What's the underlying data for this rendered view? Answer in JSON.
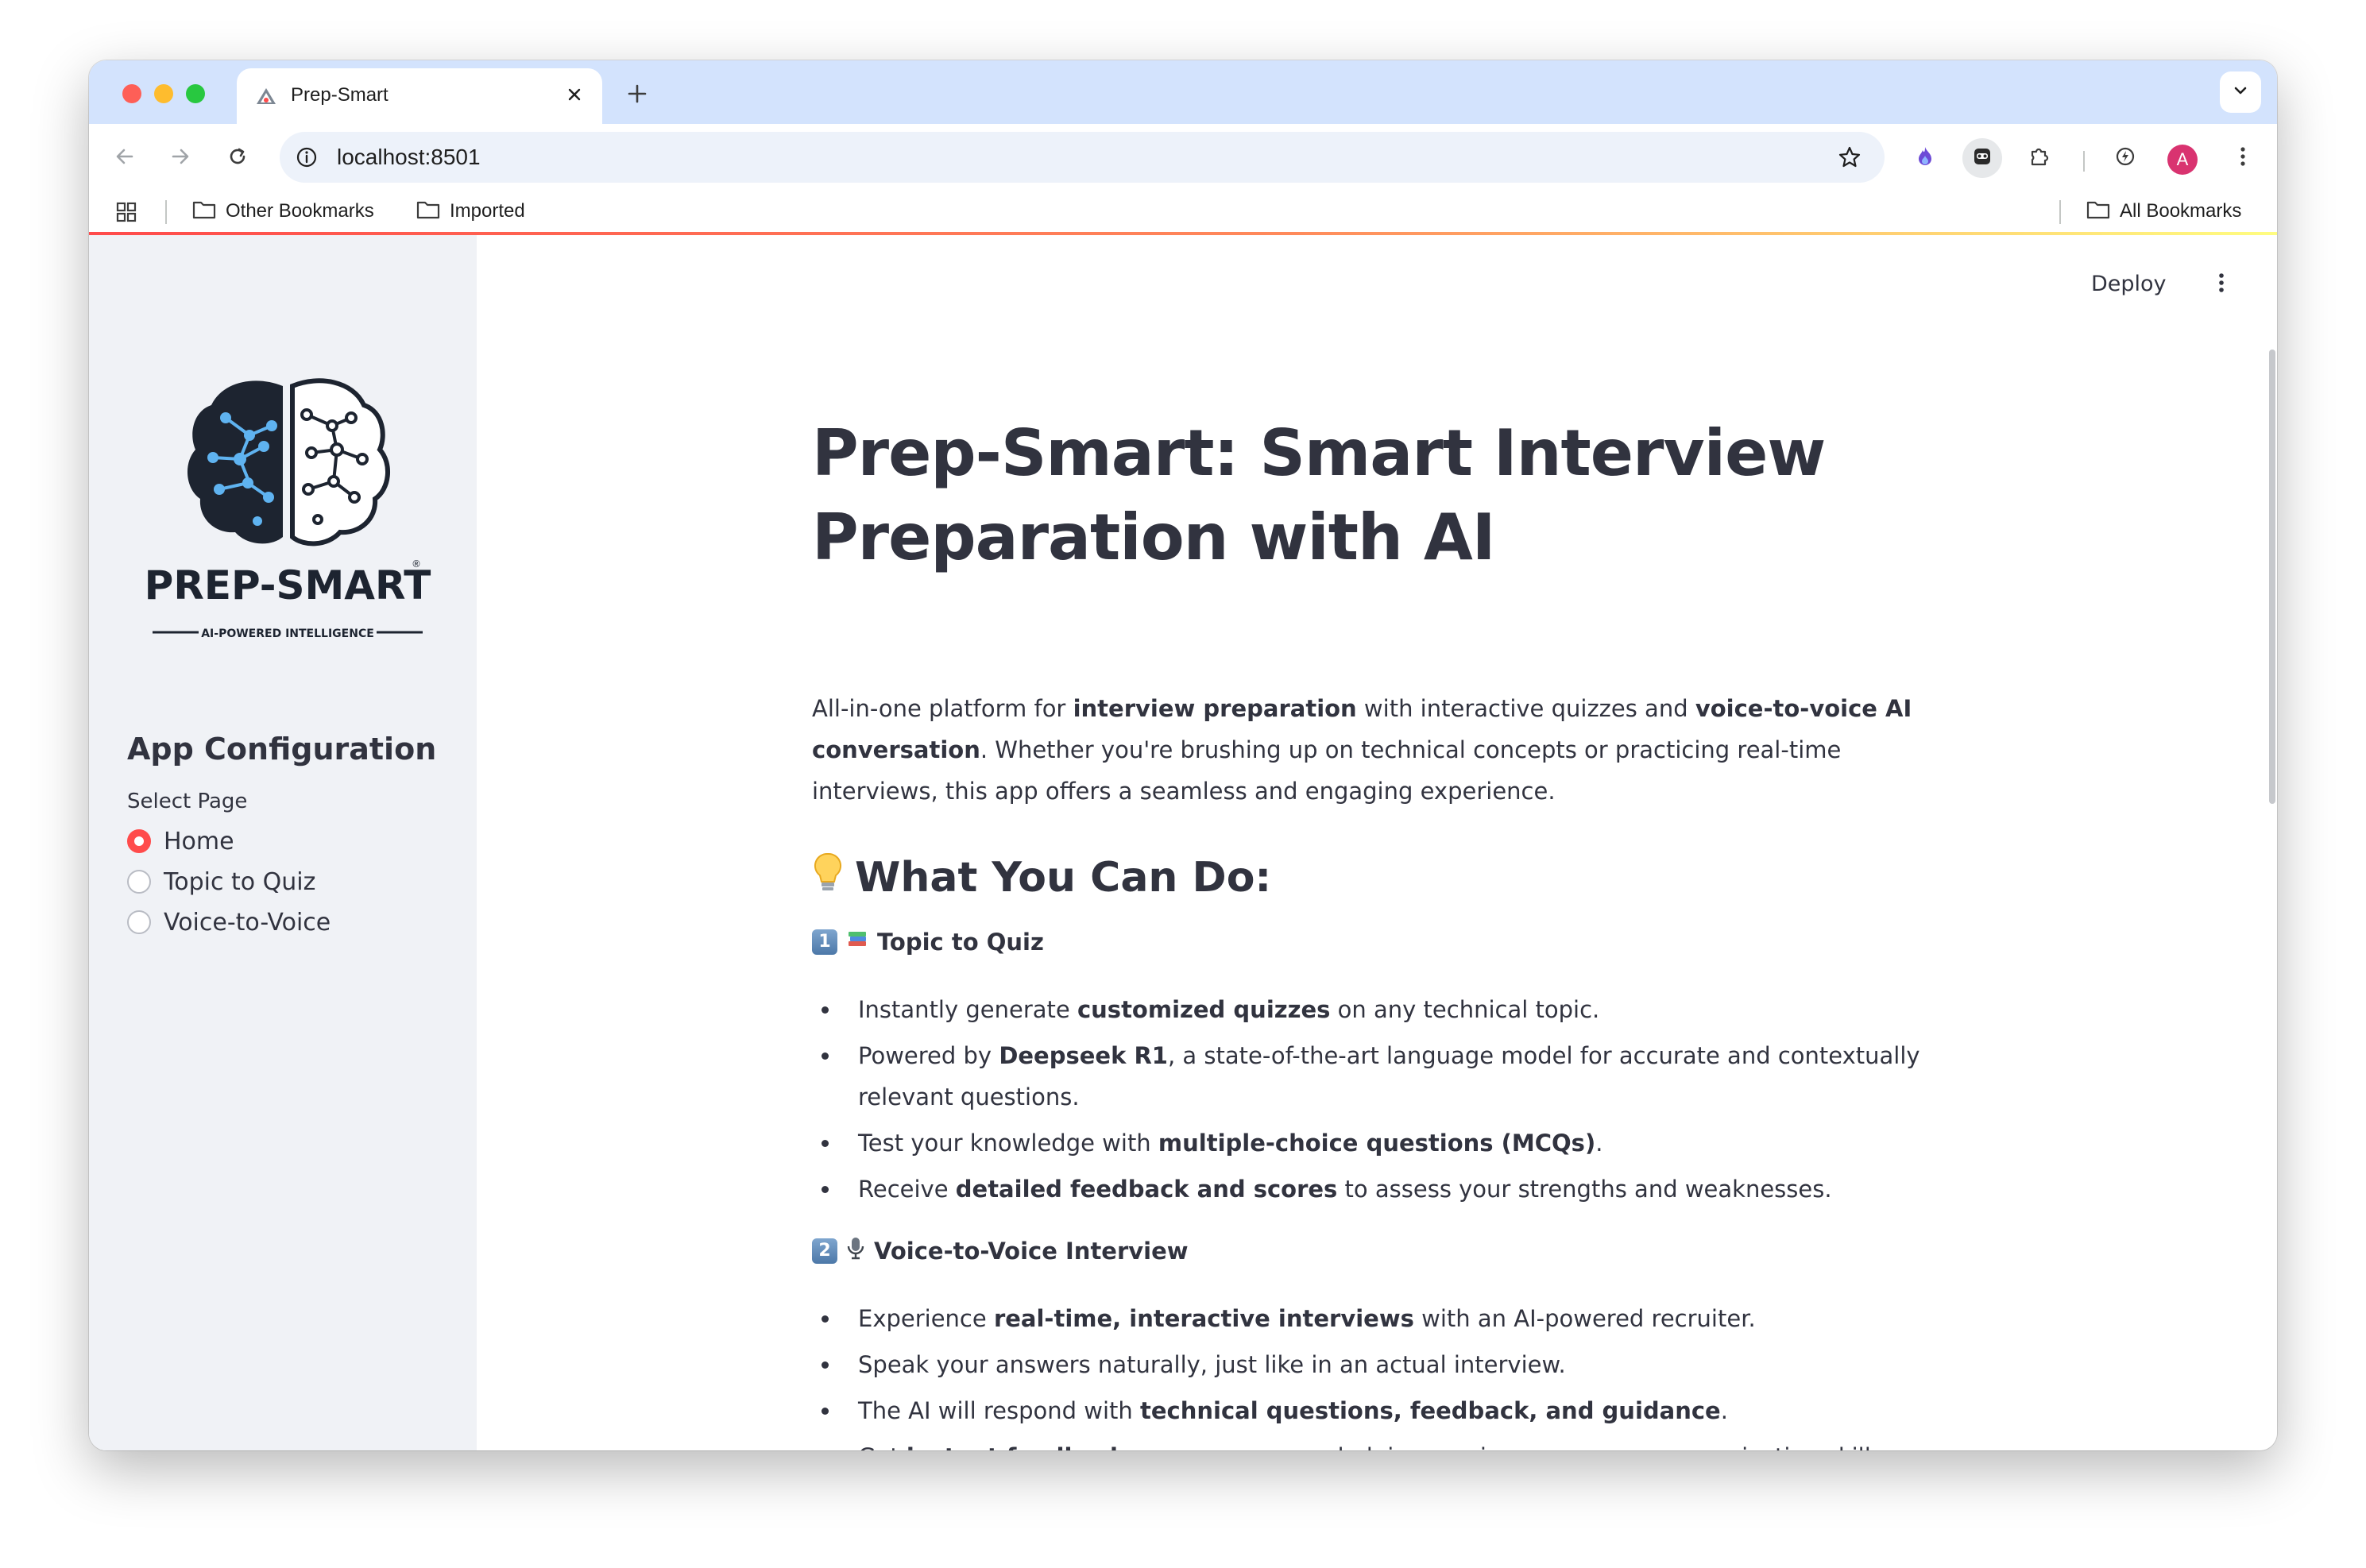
{
  "browser": {
    "tab_title": "Prep-Smart",
    "url": "localhost:8501",
    "avatar_initial": "A",
    "bookmarks": {
      "other": "Other Bookmarks",
      "imported": "Imported",
      "all": "All Bookmarks"
    }
  },
  "header": {
    "deploy": "Deploy"
  },
  "sidebar": {
    "logo_text": "PREP-SMART",
    "logo_tagline": "AI-POWERED INTELLIGENCE",
    "heading": "App Configuration",
    "select_label": "Select Page",
    "options": [
      "Home",
      "Topic to Quiz",
      "Voice-to-Voice"
    ],
    "selected": "Home"
  },
  "main": {
    "title": "Prep-Smart: Smart Interview Preparation with AI",
    "intro": {
      "t1": "All-in-one platform for ",
      "b1": "interview preparation",
      "t2": " with interactive quizzes and ",
      "b2": "voice-to-voice AI conversation",
      "t3": ". Whether you're brushing up on technical concepts or practicing real-time interviews, this app offers a seamless and engaging experience."
    },
    "what_heading": "What You Can Do:",
    "section1": {
      "num": "1",
      "title": "Topic to Quiz",
      "items": [
        {
          "pre": "Instantly generate ",
          "bold": "customized quizzes",
          "post": " on any technical topic."
        },
        {
          "pre": "Powered by ",
          "bold": "Deepseek R1",
          "post": ", a state-of-the-art language model for accurate and contextually relevant questions."
        },
        {
          "pre": "Test your knowledge with ",
          "bold": "multiple-choice questions (MCQs)",
          "post": "."
        },
        {
          "pre": "Receive ",
          "bold": "detailed feedback and scores",
          "post": " to assess your strengths and weaknesses."
        }
      ]
    },
    "section2": {
      "num": "2",
      "title": "Voice-to-Voice Interview",
      "items": [
        {
          "pre": "Experience ",
          "bold": "real-time, interactive interviews",
          "post": " with an AI-powered recruiter."
        },
        {
          "pre": "Speak your answers naturally, just like in an actual interview.",
          "bold": "",
          "post": ""
        },
        {
          "pre": "The AI will respond with ",
          "bold": "technical questions, feedback, and guidance",
          "post": "."
        },
        {
          "pre": "Get ",
          "bold": "instant feedback",
          "post": " on your answers, helping you improve your communication skills."
        }
      ]
    }
  }
}
